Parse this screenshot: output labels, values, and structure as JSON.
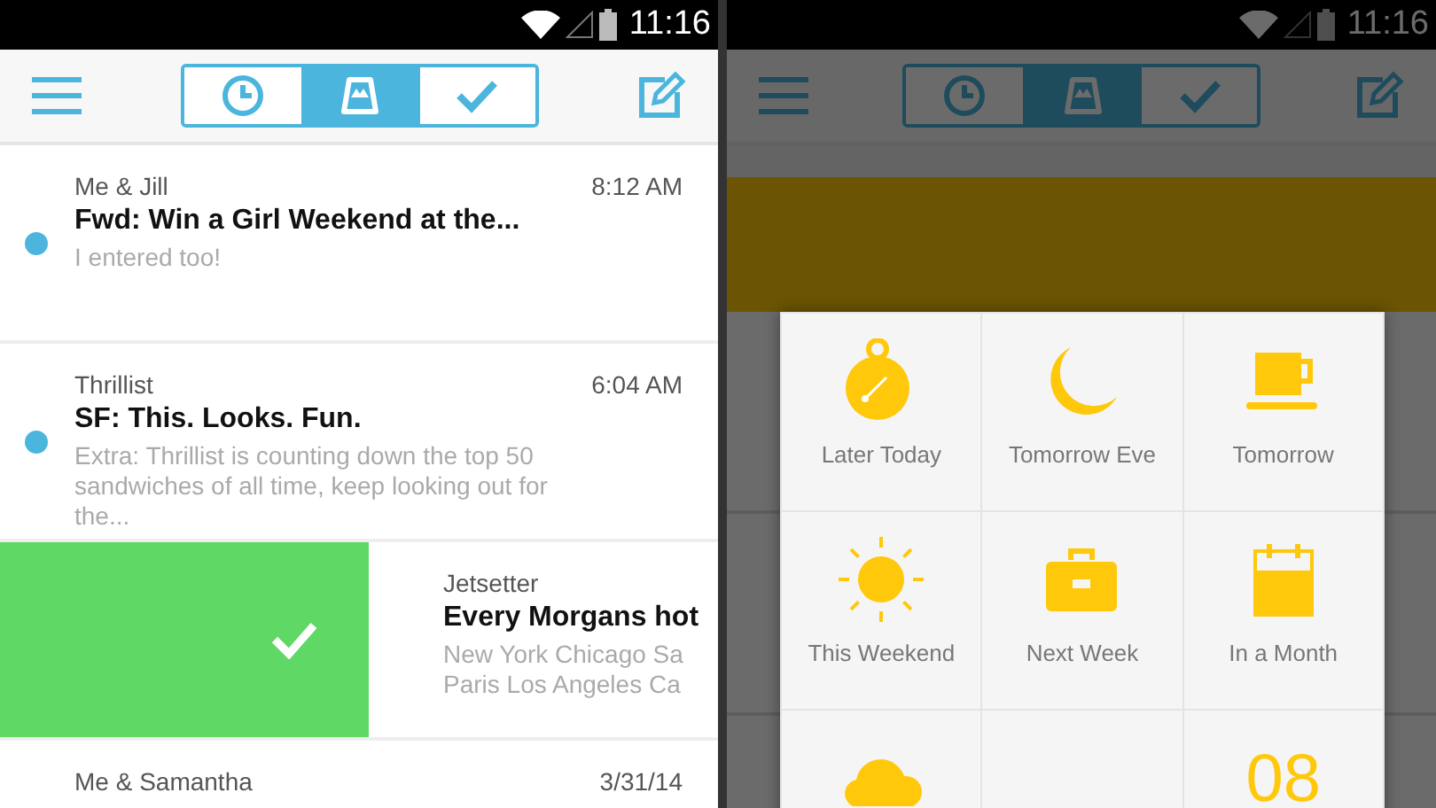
{
  "screens": [
    {
      "status_bar": {
        "time": "11:16"
      },
      "toolbar": {
        "segments": [
          {
            "kind": "clock",
            "selected": false
          },
          {
            "kind": "tray",
            "selected": true
          },
          {
            "kind": "check",
            "selected": false
          }
        ]
      },
      "messages": [
        {
          "sender": "Me & Jill",
          "time": "8:12 AM",
          "subject": "Fwd: Win a Girl Weekend at the...",
          "preview": "I entered too!",
          "unread": true
        },
        {
          "sender": "Thrillist",
          "time": "6:04 AM",
          "subject": "SF: This. Looks. Fun.",
          "preview": "Extra: Thrillist is counting down the top 50 sandwiches of all time, keep looking out for the...",
          "unread": true
        },
        {
          "sender": "Jetsetter",
          "subject": "Every Morgans hot",
          "preview": "New York Chicago Sa Paris Los Angeles Ca",
          "swiped": true
        },
        {
          "sender": "Me & Samantha",
          "time": "3/31/14"
        }
      ]
    },
    {
      "status_bar": {
        "time": "11:16"
      },
      "dimmed": true,
      "toolbar": {
        "segments": [
          {
            "kind": "clock",
            "selected": false
          },
          {
            "kind": "tray",
            "selected": true
          },
          {
            "kind": "check",
            "selected": false
          }
        ]
      },
      "snooze_menu": [
        {
          "kind": "timer",
          "label": "Later Today"
        },
        {
          "kind": "moon",
          "label": "Tomorrow Eve"
        },
        {
          "kind": "cup",
          "label": "Tomorrow"
        },
        {
          "kind": "sun",
          "label": "This Weekend"
        },
        {
          "kind": "briefcase",
          "label": "Next Week"
        },
        {
          "kind": "calendar",
          "label": "In a Month"
        },
        {
          "kind": "cloud"
        },
        {
          "kind": "blank"
        },
        {
          "kind": "date",
          "number": "08"
        }
      ]
    }
  ]
}
